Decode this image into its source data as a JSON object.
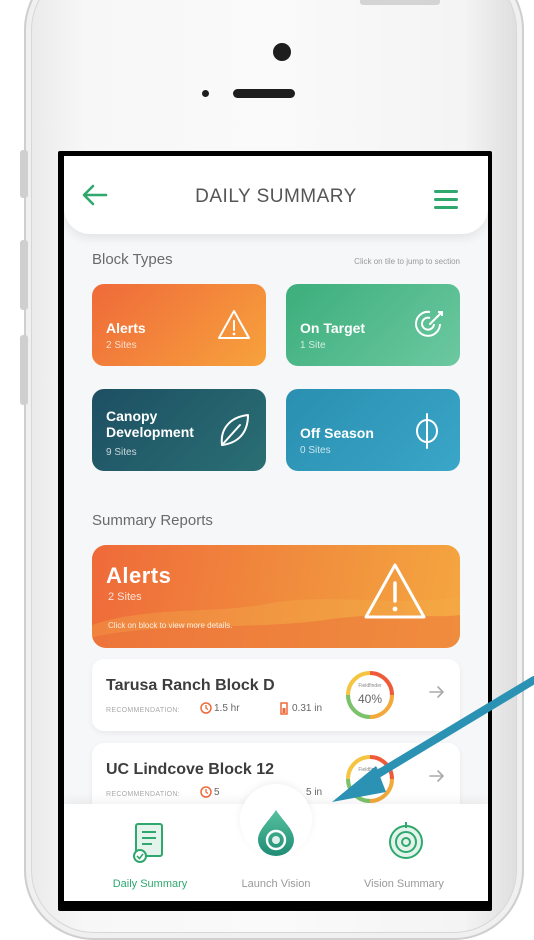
{
  "header": {
    "title": "DAILY SUMMARY"
  },
  "block_types": {
    "title": "Block Types",
    "hint": "Click on tile to jump to section",
    "tiles": [
      {
        "label": "Alerts",
        "sub": "2 Sites"
      },
      {
        "label": "On Target",
        "sub": "1 Site"
      },
      {
        "label": "Canopy Development",
        "sub": "9 Sites"
      },
      {
        "label": "Off Season",
        "sub": "0 Sites"
      }
    ]
  },
  "summary_reports": {
    "title": "Summary Reports",
    "banner": {
      "title": "Alerts",
      "sub": "2 Sites",
      "hint": "Click on block to view more details."
    },
    "cards": [
      {
        "name": "Tarusa Ranch Block D",
        "reco_label": "RECOMMENDATION:",
        "time": "1.5 hr",
        "water": "0.31 in",
        "gauge_caption": "Fieldfinder",
        "gauge_value": "40%"
      },
      {
        "name": "UC Lindcove Block 12",
        "reco_label": "RECOMMENDATION:",
        "time": "5",
        "water": "5 in",
        "gauge_caption": "Fieldfinder",
        "gauge_value": ""
      }
    ]
  },
  "tabbar": {
    "tabs": [
      {
        "label": "Daily Summary",
        "active": true
      },
      {
        "label": "Launch Vision",
        "active": false
      },
      {
        "label": "Vision Summary",
        "active": false
      }
    ]
  },
  "colors": {
    "accent_green": "#2fa86e",
    "alert_orange": "#ef6a3a",
    "pointer_blue": "#2b92b3"
  }
}
